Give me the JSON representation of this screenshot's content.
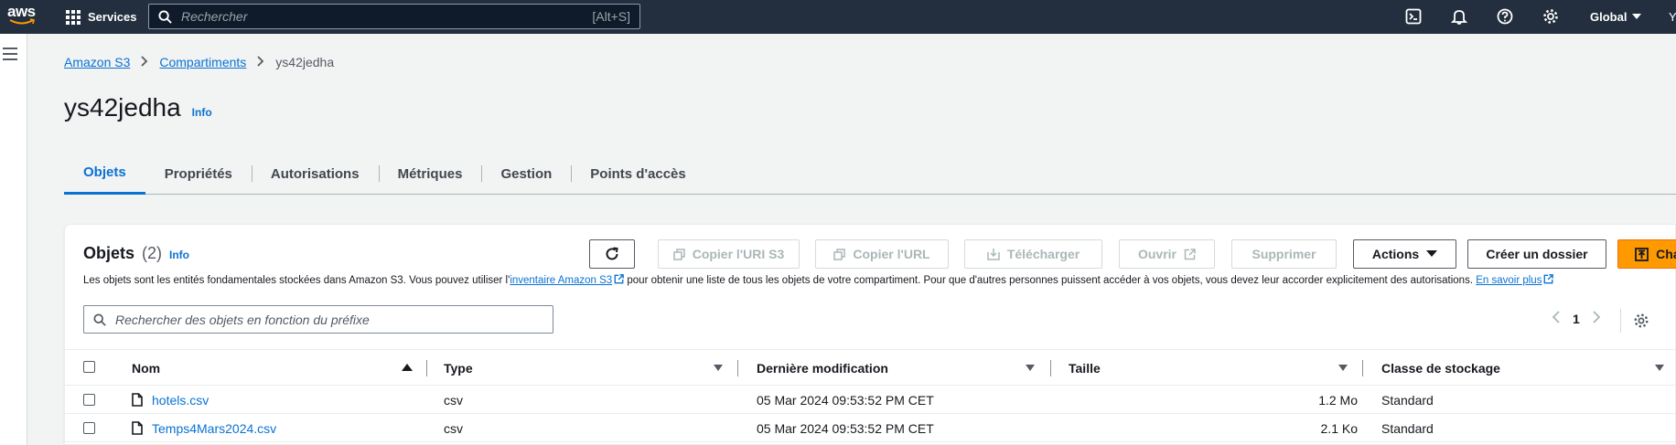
{
  "topnav": {
    "logo_text": "aws",
    "services_label": "Services",
    "search_placeholder": "Rechercher",
    "search_shortcut": "[Alt+S]",
    "region": "Global",
    "account_initial": "Y"
  },
  "breadcrumb": {
    "items": [
      "Amazon S3",
      "Compartiments"
    ],
    "current": "ys42jedha"
  },
  "page": {
    "title": "ys42jedha",
    "info": "Info"
  },
  "tabs": [
    "Objets",
    "Propriétés",
    "Autorisations",
    "Métriques",
    "Gestion",
    "Points d'accès"
  ],
  "panel": {
    "title": "Objets",
    "count": "(2)",
    "info": "Info",
    "desc_pre": "Les objets sont les entités fondamentales stockées dans Amazon S3. Vous pouvez utiliser l'",
    "desc_link": "inventaire Amazon S3",
    "desc_mid": " pour obtenir une liste de tous les objets de votre compartiment. Pour que d'autres personnes puissent accéder à vos objets, vous devez leur accorder explicitement des autorisations. ",
    "desc_link2": "En savoir plus",
    "buttons": {
      "copy_uri": "Copier l'URI S3",
      "copy_url": "Copier l'URL",
      "download": "Télécharger",
      "open": "Ouvrir",
      "delete": "Supprimer",
      "actions": "Actions",
      "create_folder": "Créer un dossier",
      "upload": "Charger"
    },
    "search_placeholder": "Rechercher des objets en fonction du préfixe",
    "page_number": "1"
  },
  "table": {
    "headers": [
      "Nom",
      "Type",
      "Dernière modification",
      "Taille",
      "Classe de stockage"
    ],
    "rows": [
      {
        "name": "hotels.csv",
        "type": "csv",
        "modified": "05 Mar 2024 09:53:52 PM CET",
        "size": "1.2 Mo",
        "storage": "Standard"
      },
      {
        "name": "Temps4Mars2024.csv",
        "type": "csv",
        "modified": "05 Mar 2024 09:53:52 PM CET",
        "size": "2.1 Ko",
        "storage": "Standard"
      }
    ]
  },
  "colors": {
    "nav_bg": "#232f3e",
    "link": "#0972d3",
    "primary": "#ff9900"
  }
}
